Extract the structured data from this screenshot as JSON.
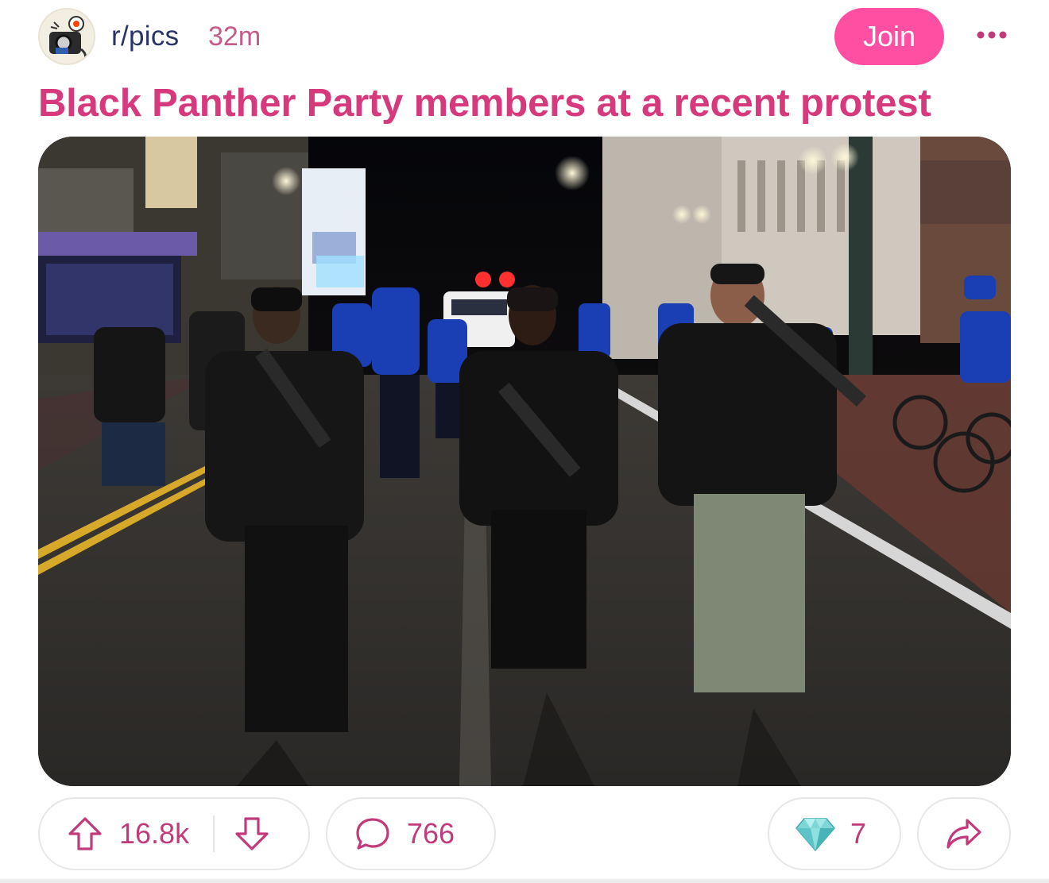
{
  "header": {
    "subreddit": "r/pics",
    "time": "32m",
    "join_label": "Join"
  },
  "post": {
    "title": "Black Panther Party members at a recent protest"
  },
  "actions": {
    "upvotes": "16.8k",
    "comments": "766",
    "awards": "7"
  },
  "colors": {
    "accent": "#ff4fa3",
    "title": "#d63a7d",
    "subreddit": "#2a3565",
    "count": "#c23a7a"
  },
  "icons": {
    "upvote": "arrow-up-icon",
    "downvote": "arrow-down-icon",
    "comment": "speech-bubble-icon",
    "award": "diamond-icon",
    "share": "share-arrow-icon",
    "more": "ellipsis-icon"
  }
}
